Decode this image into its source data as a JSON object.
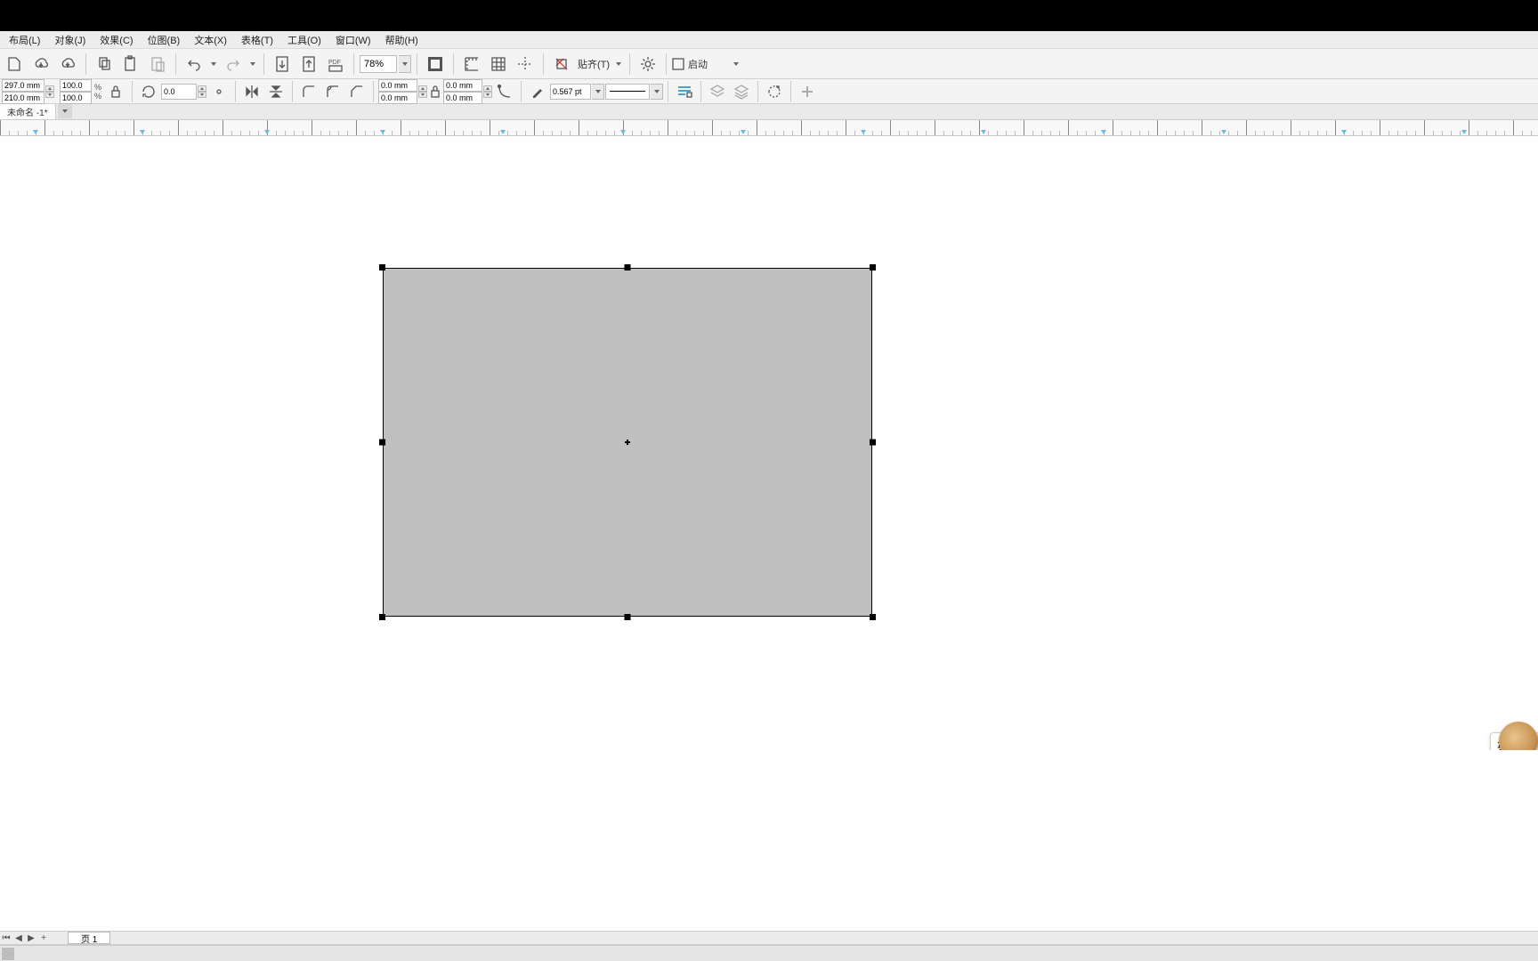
{
  "menu": {
    "items": [
      "布局(L)",
      "对象(J)",
      "效果(C)",
      "位图(B)",
      "文本(X)",
      "表格(T)",
      "工具(O)",
      "窗口(W)",
      "帮助(H)"
    ]
  },
  "toolbar": {
    "zoom": "78%",
    "align_label": "贴齐(T)",
    "launch_label": "启动"
  },
  "propbar": {
    "width": "297.0 mm",
    "height": "210.0 mm",
    "scale_x": "100.0",
    "scale_y": "100.0",
    "percent": "%",
    "rotation": "0.0",
    "corner1_x": "0.0 mm",
    "corner1_y": "0.0 mm",
    "corner2_x": "0.0 mm",
    "corner2_y": "0.0 mm",
    "outline_width": "0.567 pt"
  },
  "doctab": {
    "name": "未命名 -1*"
  },
  "pagenav": {
    "first": "⏮",
    "prev": "◀",
    "next": "▶",
    "add": "+",
    "page_label": "页 1"
  },
  "ime": {
    "tl": "英",
    "tr": "☽",
    "bl": "•",
    "br": "■"
  }
}
